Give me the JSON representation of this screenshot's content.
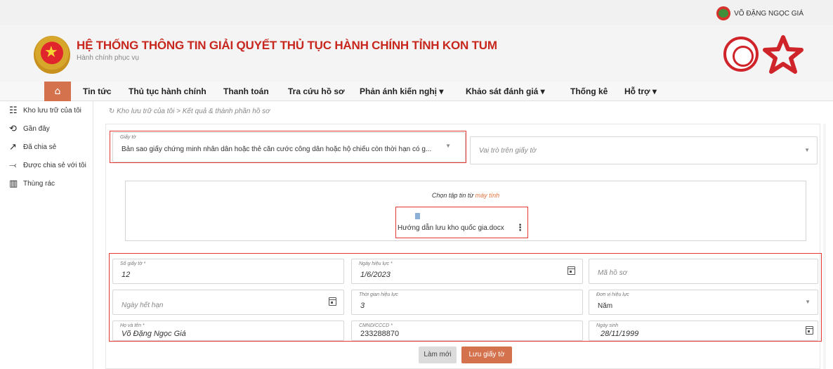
{
  "user": {
    "name": "VÕ ĐẶNG NGỌC GIÁ"
  },
  "header": {
    "title": "HỆ THỐNG THÔNG TIN GIẢI QUYẾT THỦ TỤC HÀNH CHÍNH   TỈNH KON TUM",
    "subtitle": "Hành chính phục vụ"
  },
  "nav": {
    "home_icon": "home-icon",
    "items": [
      "Tin tức",
      "Thủ tục hành chính",
      "Thanh toán",
      "Tra cứu hồ sơ",
      "Phản ánh kiến nghị ▾",
      "Khảo sát đánh giá ▾",
      "Thống kê",
      "Hỗ trợ ▾"
    ]
  },
  "sidebar": {
    "items": [
      {
        "label": "Kho lưu trữ của tôi",
        "icon": "storage-search-icon"
      },
      {
        "label": "Gần đây",
        "icon": "history-icon"
      },
      {
        "label": "Đã chia sẻ",
        "icon": "share-icon"
      },
      {
        "label": "Được chia sẻ với tôi",
        "icon": "shared-with-me-icon"
      },
      {
        "label": "Thùng rác",
        "icon": "trash-icon"
      }
    ]
  },
  "breadcrumb": {
    "path": "Kho lưu trữ của tôi  >  Kết quả & thành phần hồ sơ"
  },
  "form": {
    "giay_to": {
      "label": "Giấy tờ",
      "value": "Bản sao giấy chứng minh nhân dân hoặc thẻ căn cước công dân hoặc hộ chiếu còn thời hạn có g..."
    },
    "vai_tro": {
      "placeholder": "Vai trò trên giấy tờ"
    },
    "upload": {
      "prompt": "Chọn tập tin từ ",
      "link": "máy tính",
      "file_name": "Hướng dẫn lưu kho quốc gia.docx"
    },
    "so_giay_to": {
      "label": "Số giấy tờ *",
      "value": "12"
    },
    "ngay_hieu_luc": {
      "label": "Ngày hiệu lực *",
      "value": "1/6/2023"
    },
    "ma_ho_so": {
      "placeholder": "Mã hồ sơ"
    },
    "ngay_het_han": {
      "placeholder": "Ngày hết hạn"
    },
    "thoi_gian_hieu_luc": {
      "label": "Thời gian hiệu lực",
      "value": "3"
    },
    "don_vi_hieu_luc": {
      "label": "Đơn vị hiệu lực",
      "value": "Năm"
    },
    "ho_va_ten": {
      "label": "Họ và tên *",
      "value": "Võ Đặng Ngọc Giá"
    },
    "cmnd": {
      "label": "CMND/CCCD *",
      "value": "233288870"
    },
    "ngay_sinh": {
      "label": "Ngày sinh",
      "value": "28/11/1999"
    }
  },
  "buttons": {
    "reset": "Làm mới",
    "save": "Lưu giấy tờ"
  },
  "colors": {
    "brand_red": "#c7271d",
    "accent": "#d4724e",
    "highlight_border": "#e53935"
  }
}
